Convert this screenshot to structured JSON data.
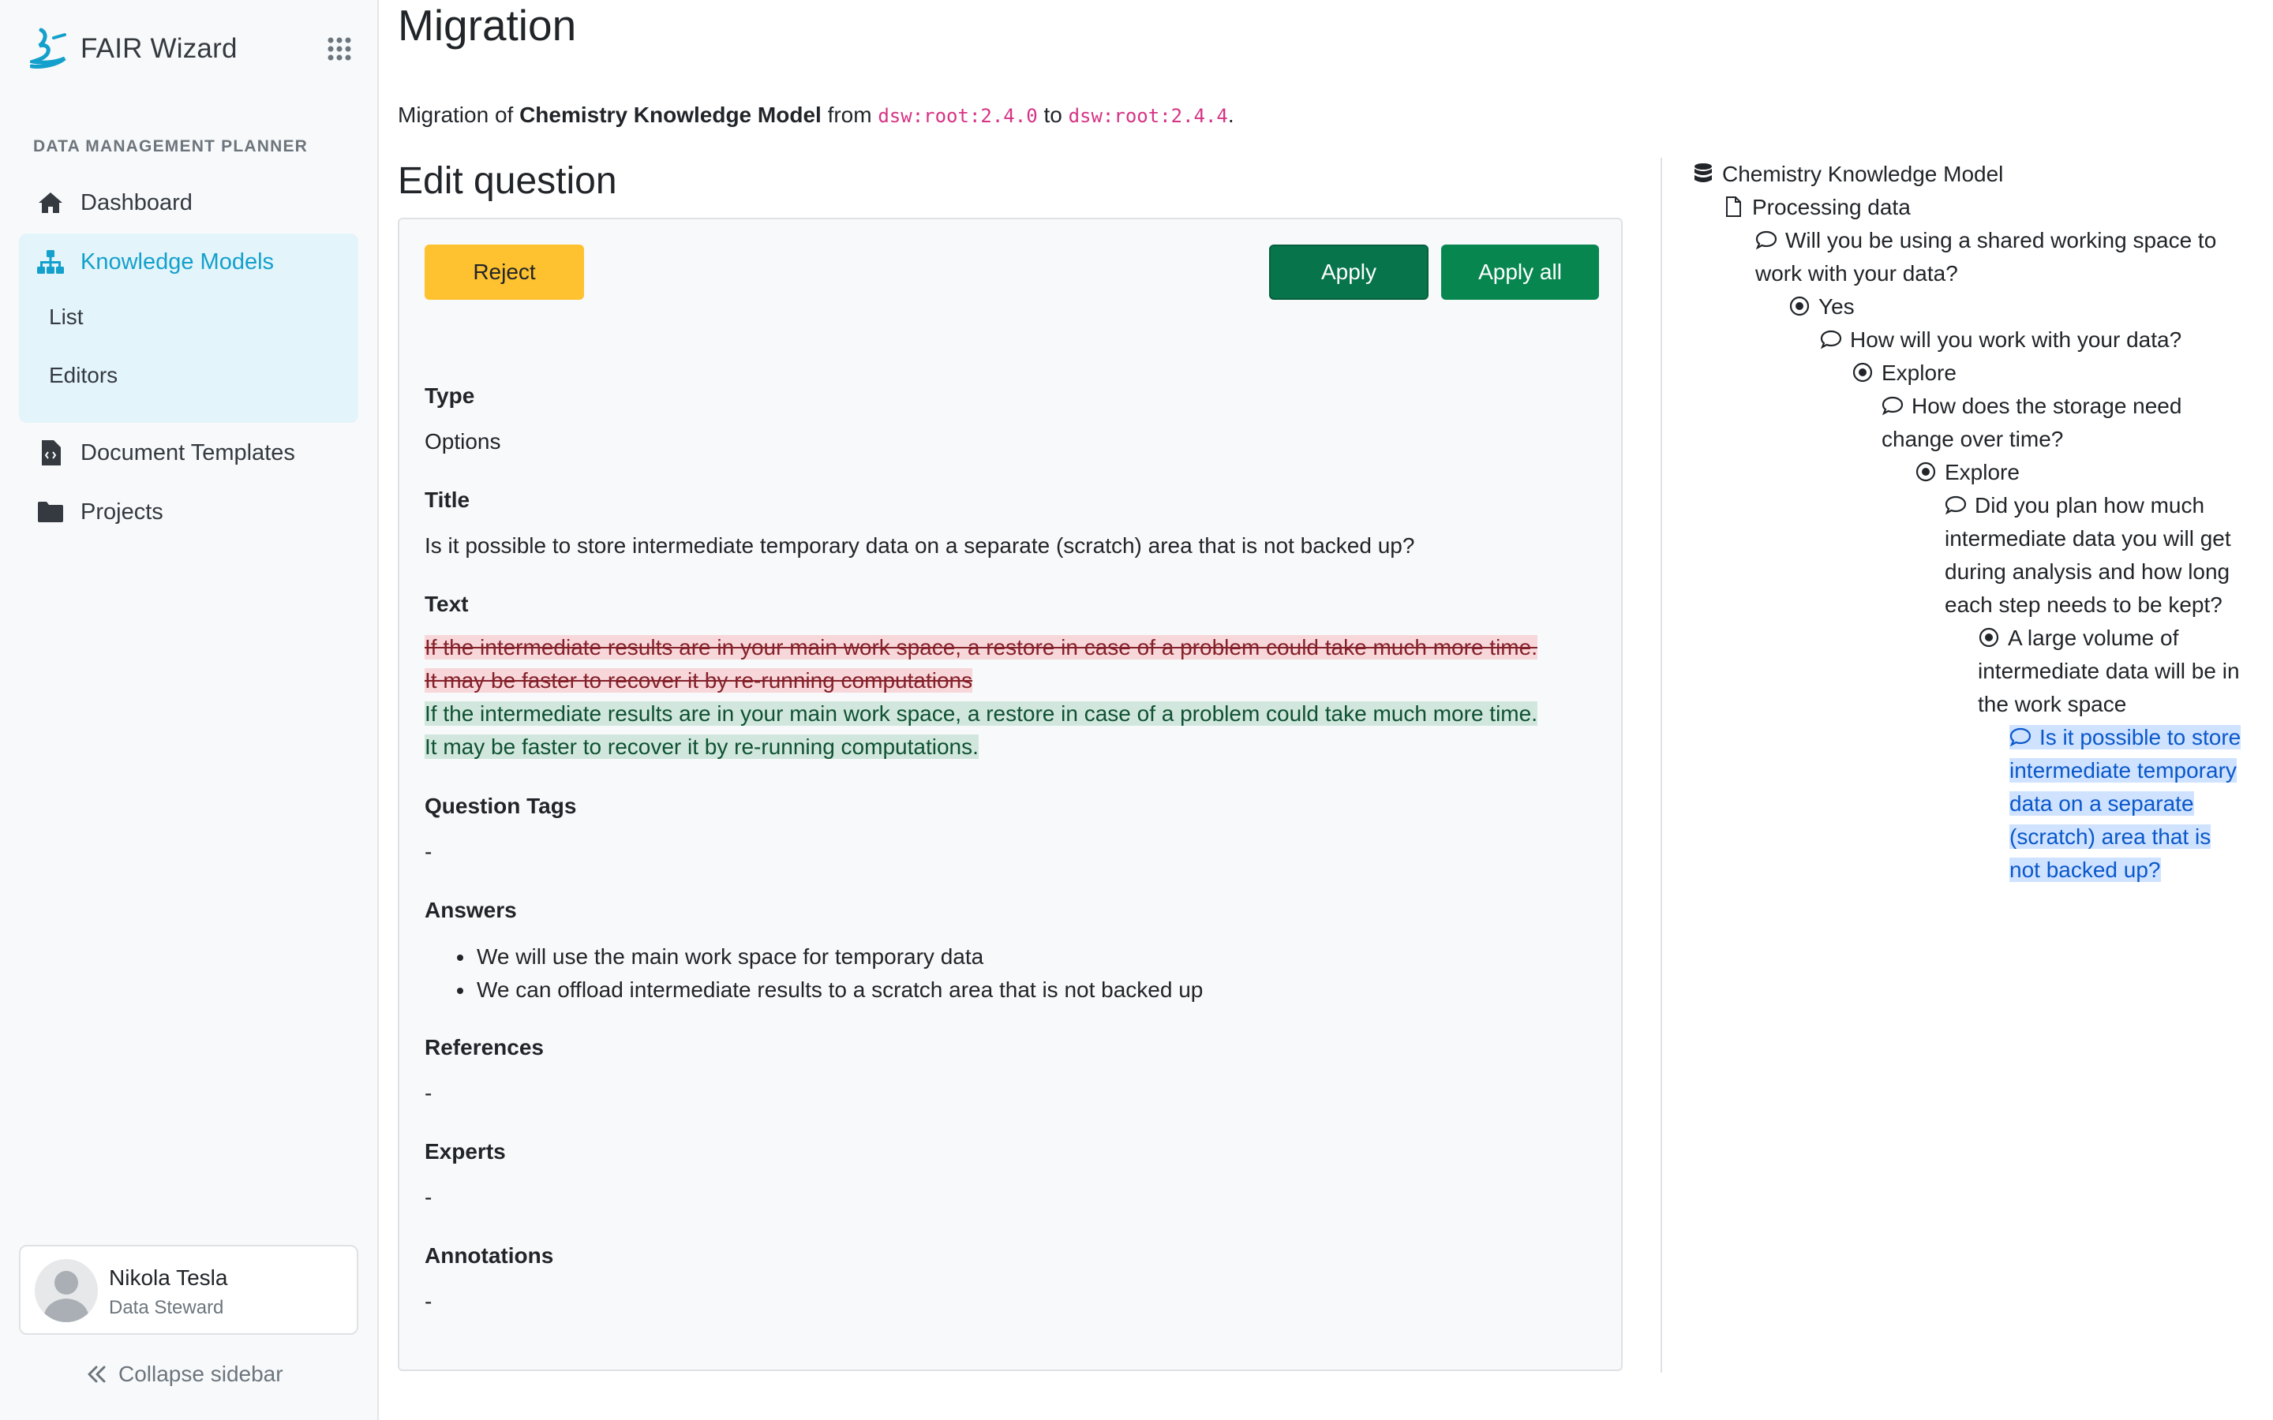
{
  "brand": {
    "name": "FAIR Wizard"
  },
  "sidebar": {
    "section_title": "DATA MANAGEMENT PLANNER",
    "items": [
      {
        "label": "Dashboard",
        "icon": "home-icon"
      },
      {
        "label": "Knowledge Models",
        "icon": "sitemap-icon",
        "active": true,
        "children": [
          {
            "label": "List"
          },
          {
            "label": "Editors"
          }
        ]
      },
      {
        "label": "Document Templates",
        "icon": "file-code-icon"
      },
      {
        "label": "Projects",
        "icon": "folder-icon"
      }
    ],
    "user": {
      "name": "Nikola Tesla",
      "role": "Data Steward"
    },
    "collapse_label": "Collapse sidebar"
  },
  "page": {
    "title": "Migration",
    "migration": {
      "prefix": "Migration of",
      "km_name": "Chemistry Knowledge Model",
      "from_word": "from",
      "from_id": "dsw:root:2.4.0",
      "to_word": "to",
      "to_id": "dsw:root:2.4.4",
      "suffix": "."
    },
    "edit_title": "Edit question"
  },
  "card": {
    "reject_label": "Reject",
    "apply_label": "Apply",
    "apply_all_label": "Apply all",
    "type_label": "Type",
    "type_value": "Options",
    "title_label": "Title",
    "title_value": "Is it possible to store intermediate temporary data on a separate (scratch) area that is not backed up?",
    "text_label": "Text",
    "text_old_line1": "If the intermediate results are in your main work space, a restore in case of a problem could take much more time.",
    "text_old_line2": "It may be faster to recover it by re-running computations",
    "text_new_line1": "If the intermediate results are in your main work space, a restore in case of a problem could take much more time.",
    "text_new_line2": "It may be faster to recover it by re-running computations.",
    "tags_label": "Question Tags",
    "tags_value": "-",
    "answers_label": "Answers",
    "answers": [
      "We will use the main work space for temporary data",
      "We can offload intermediate results to a scratch area that is not backed up"
    ],
    "references_label": "References",
    "references_value": "-",
    "experts_label": "Experts",
    "experts_value": "-",
    "annotations_label": "Annotations",
    "annotations_value": "-"
  },
  "tree": {
    "km": "Chemistry Knowledge Model",
    "chapter": "Processing data",
    "q1_line1": "Will you be using a shared working space to",
    "q1_line2": "work with your data?",
    "a1": "Yes",
    "q2": "How will you work with your data?",
    "a2": "Explore",
    "q3_line1": "How does the storage need",
    "q3_line2": "change over time?",
    "a3": "Explore",
    "q4_line1": "Did you plan how much",
    "q4_line2": "intermediate data you will get",
    "q4_line3": "during analysis and how long",
    "q4_line4": "each step needs to be kept?",
    "a4_line1": "A large volume of",
    "a4_line2": "intermediate data will be in",
    "a4_line3": "the work space",
    "q5_line1": "Is it possible to store",
    "q5_line2": "intermediate temporary",
    "q5_line3": "data on a separate",
    "q5_line4": "(scratch) area that is",
    "q5_line5": "not backed up?"
  }
}
